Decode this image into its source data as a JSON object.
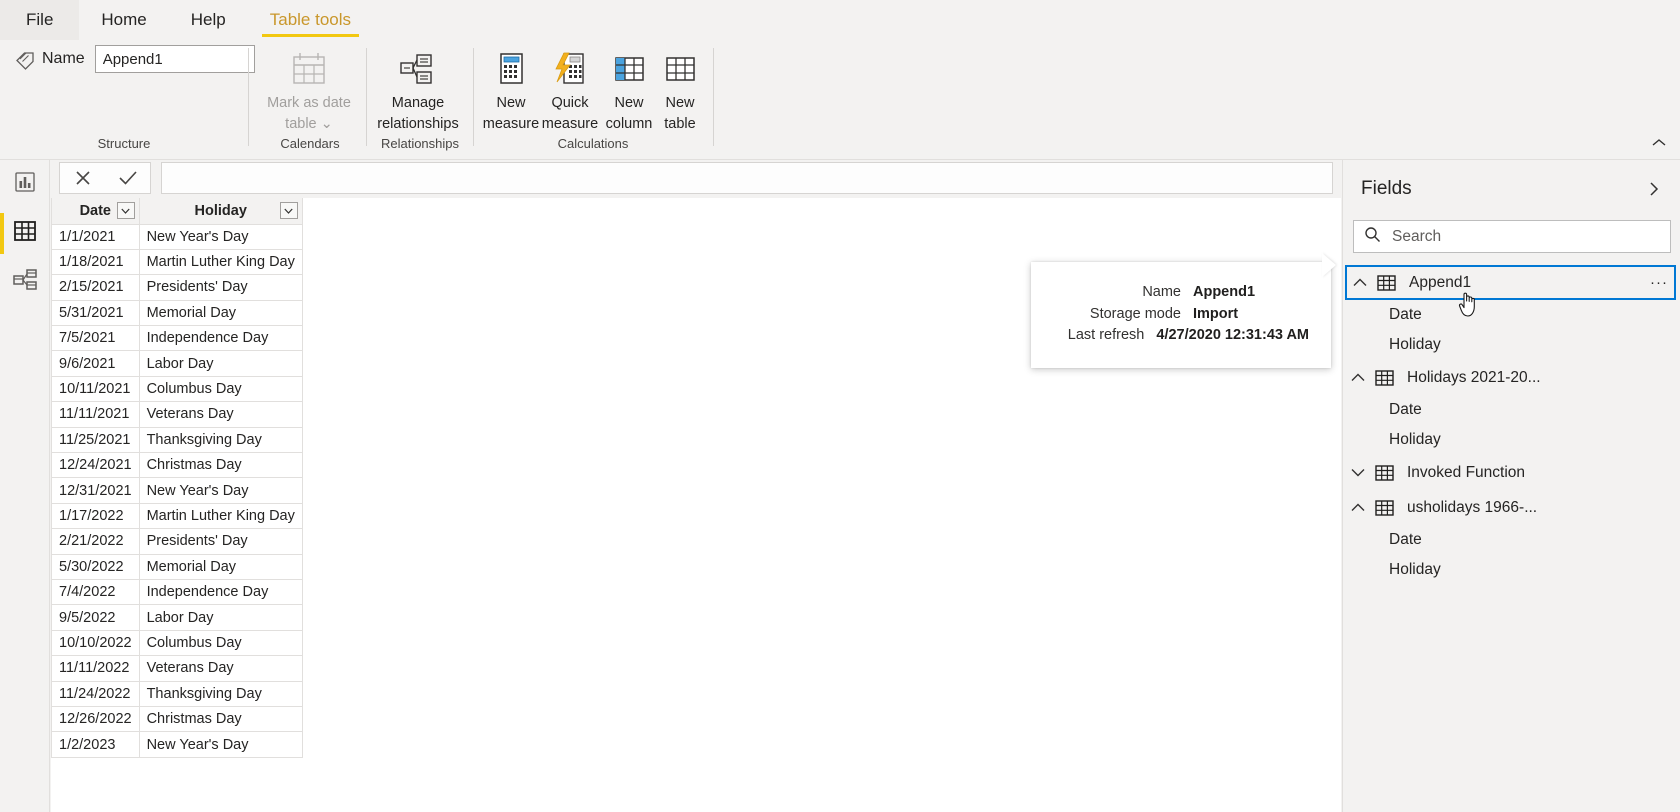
{
  "app": {
    "accent_yellow": "#f2c811",
    "selection_blue": "#0078d4",
    "chrome_bg": "#f3f2f1"
  },
  "ribbon": {
    "tabs": [
      {
        "label": "File",
        "active": false
      },
      {
        "label": "Home",
        "active": false
      },
      {
        "label": "Help",
        "active": false
      },
      {
        "label": "Table tools",
        "active": true
      }
    ],
    "name_label": "Name",
    "name_value": "Append1",
    "name_placeholder": "Name",
    "groups": [
      {
        "label": "Structure"
      },
      {
        "label": "Calendars"
      },
      {
        "label": "Relationships"
      },
      {
        "label": "Calculations"
      }
    ],
    "buttons": {
      "mark_as_date_table": "Mark as date\ntable",
      "mark_as_date_table_l1": "Mark as date",
      "mark_as_date_table_l2": "table",
      "manage_relationships_l1": "Manage",
      "manage_relationships_l2": "relationships",
      "new_measure_l1": "New",
      "new_measure_l2": "measure",
      "quick_measure_l1": "Quick",
      "quick_measure_l2": "measure",
      "new_column_l1": "New",
      "new_column_l2": "column",
      "new_table_l1": "New",
      "new_table_l2": "table"
    }
  },
  "leftnav": {
    "items": [
      {
        "name": "report-view",
        "active": false
      },
      {
        "name": "data-view",
        "active": true
      },
      {
        "name": "model-view",
        "active": false
      }
    ]
  },
  "formula_bar": {
    "value": "",
    "placeholder": ""
  },
  "grid": {
    "columns": [
      "Date",
      "Holiday"
    ],
    "rows": [
      [
        "1/1/2021",
        "New Year's Day"
      ],
      [
        "1/18/2021",
        "Martin Luther King Day"
      ],
      [
        "2/15/2021",
        "Presidents' Day"
      ],
      [
        "5/31/2021",
        "Memorial Day"
      ],
      [
        "7/5/2021",
        "Independence Day"
      ],
      [
        "9/6/2021",
        "Labor Day"
      ],
      [
        "10/11/2021",
        "Columbus Day"
      ],
      [
        "11/11/2021",
        "Veterans Day"
      ],
      [
        "11/25/2021",
        "Thanksgiving Day"
      ],
      [
        "12/24/2021",
        "Christmas Day"
      ],
      [
        "12/31/2021",
        "New Year's Day"
      ],
      [
        "1/17/2022",
        "Martin Luther King Day"
      ],
      [
        "2/21/2022",
        "Presidents' Day"
      ],
      [
        "5/30/2022",
        "Memorial Day"
      ],
      [
        "7/4/2022",
        "Independence Day"
      ],
      [
        "9/5/2022",
        "Labor Day"
      ],
      [
        "10/10/2022",
        "Columbus Day"
      ],
      [
        "11/11/2022",
        "Veterans Day"
      ],
      [
        "11/24/2022",
        "Thanksgiving Day"
      ],
      [
        "12/26/2022",
        "Christmas Day"
      ],
      [
        "1/2/2023",
        "New Year's Day"
      ]
    ]
  },
  "tooltip": {
    "rows": [
      {
        "key": "Name",
        "value": "Append1"
      },
      {
        "key": "Storage mode",
        "value": "Import"
      },
      {
        "key": "Last refresh",
        "value": "4/27/2020 12:31:43 AM"
      }
    ]
  },
  "fields": {
    "title": "Fields",
    "search_placeholder": "Search",
    "more_label": "···",
    "tables": [
      {
        "name": "Append1",
        "expanded": true,
        "selected": true,
        "fields": [
          "Date",
          "Holiday"
        ]
      },
      {
        "name": "Holidays 2021-20...",
        "expanded": true,
        "selected": false,
        "fields": [
          "Date",
          "Holiday"
        ]
      },
      {
        "name": "Invoked Function",
        "expanded": false,
        "selected": false,
        "fields": []
      },
      {
        "name": "usholidays 1966-...",
        "expanded": true,
        "selected": false,
        "fields": [
          "Date",
          "Holiday"
        ]
      }
    ]
  }
}
